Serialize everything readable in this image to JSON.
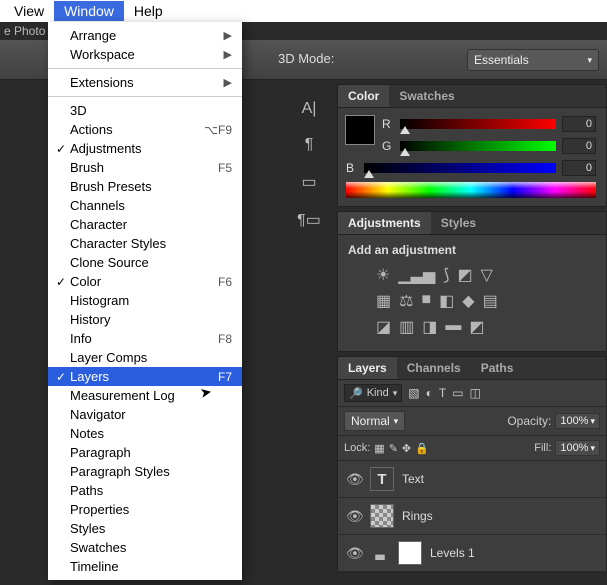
{
  "menubar": {
    "items": [
      "View",
      "Window",
      "Help"
    ],
    "active_index": 1
  },
  "app_label_fragment": "e Photo",
  "toolbar": {
    "mode_label": "3D Mode:",
    "workspace_dropdown": "Essentials"
  },
  "window_menu": {
    "items": [
      {
        "label": "Arrange",
        "submenu": true
      },
      {
        "label": "Workspace",
        "submenu": true
      },
      {
        "sep": true
      },
      {
        "label": "Extensions",
        "submenu": true
      },
      {
        "sep": true
      },
      {
        "label": "3D"
      },
      {
        "label": "Actions",
        "accel": "⌥F9"
      },
      {
        "label": "Adjustments",
        "checked": true
      },
      {
        "label": "Brush",
        "accel": "F5"
      },
      {
        "label": "Brush Presets"
      },
      {
        "label": "Channels"
      },
      {
        "label": "Character"
      },
      {
        "label": "Character Styles"
      },
      {
        "label": "Clone Source"
      },
      {
        "label": "Color",
        "checked": true,
        "accel": "F6"
      },
      {
        "label": "Histogram"
      },
      {
        "label": "History"
      },
      {
        "label": "Info",
        "accel": "F8"
      },
      {
        "label": "Layer Comps"
      },
      {
        "label": "Layers",
        "checked": true,
        "accel": "F7",
        "highlighted": true
      },
      {
        "label": "Measurement Log"
      },
      {
        "label": "Navigator"
      },
      {
        "label": "Notes"
      },
      {
        "label": "Paragraph"
      },
      {
        "label": "Paragraph Styles"
      },
      {
        "label": "Paths"
      },
      {
        "label": "Properties"
      },
      {
        "label": "Styles"
      },
      {
        "label": "Swatches"
      },
      {
        "label": "Timeline"
      }
    ]
  },
  "color_panel": {
    "tabs": [
      "Color",
      "Swatches"
    ],
    "active_tab": 0,
    "channels": [
      {
        "label": "R",
        "value": "0"
      },
      {
        "label": "G",
        "value": "0"
      },
      {
        "label": "B",
        "value": "0"
      }
    ]
  },
  "adjustments_panel": {
    "tabs": [
      "Adjustments",
      "Styles"
    ],
    "active_tab": 0,
    "title": "Add an adjustment"
  },
  "layers_panel": {
    "tabs": [
      "Layers",
      "Channels",
      "Paths"
    ],
    "active_tab": 0,
    "filter_label": "Kind",
    "blend_mode": "Normal",
    "opacity_label": "Opacity:",
    "opacity_value": "100%",
    "lock_label": "Lock:",
    "fill_label": "Fill:",
    "fill_value": "100%",
    "layers": [
      {
        "name": "Text",
        "type": "text"
      },
      {
        "name": "Rings",
        "type": "pixel"
      },
      {
        "name": "Levels 1",
        "type": "adjustment"
      }
    ]
  }
}
